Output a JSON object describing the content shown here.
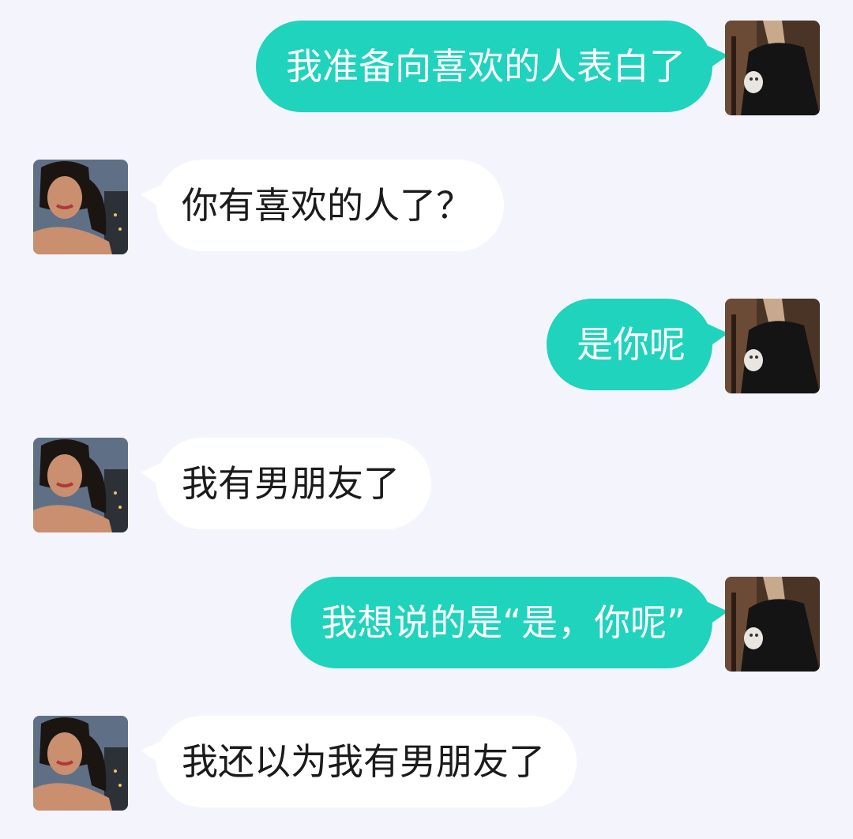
{
  "messages": [
    {
      "side": "right",
      "text": "我准备向喜欢的人表白了"
    },
    {
      "side": "left",
      "text": "你有喜欢的人了？"
    },
    {
      "side": "right",
      "text": "是你呢"
    },
    {
      "side": "left",
      "text": "我有男朋友了"
    },
    {
      "side": "right",
      "text": "我想说的是“是，你呢”"
    },
    {
      "side": "left",
      "text": "我还以为我有男朋友了"
    }
  ],
  "colors": {
    "background": "#f4f5fc",
    "sent_bubble": "#1fd3bd",
    "received_bubble": "#ffffff"
  }
}
